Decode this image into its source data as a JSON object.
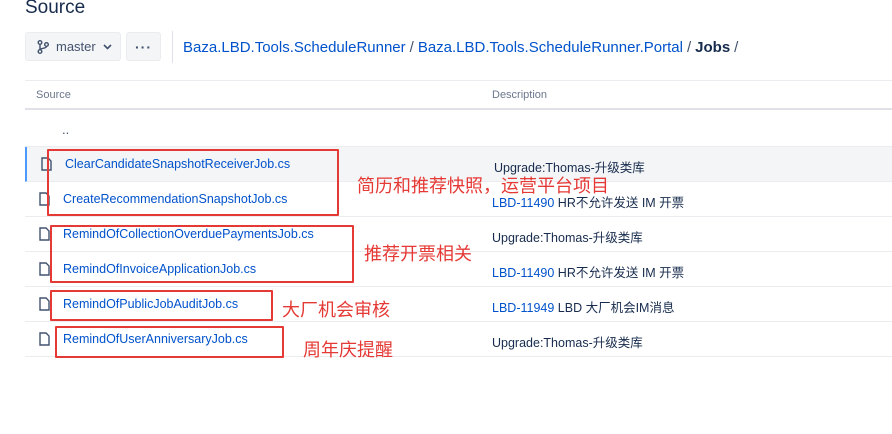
{
  "page": {
    "title": "Source"
  },
  "toolbar": {
    "branch_label": "master",
    "more_label": "···"
  },
  "breadcrumb": {
    "items": [
      "Baza.LBD.Tools.ScheduleRunner",
      "Baza.LBD.Tools.ScheduleRunner.Portal"
    ],
    "current": "Jobs",
    "separator": "/"
  },
  "table": {
    "headers": {
      "source": "Source",
      "description": "Description"
    },
    "updir": "..",
    "rows": [
      {
        "name": "ClearCandidateSnapshotReceiverJob.cs",
        "issue": "",
        "desc": "Upgrade:Thomas-升级类库",
        "selected": true
      },
      {
        "name": "CreateRecommendationSnapshotJob.cs",
        "issue": "LBD-11490",
        "desc": " HR不允许发送 IM 开票"
      },
      {
        "name": "RemindOfCollectionOverduePaymentsJob.cs",
        "issue": "",
        "desc": "Upgrade:Thomas-升级类库"
      },
      {
        "name": "RemindOfInvoiceApplicationJob.cs",
        "issue": "LBD-11490",
        "desc": " HR不允许发送 IM 开票"
      },
      {
        "name": "RemindOfPublicJobAuditJob.cs",
        "issue": "LBD-11949",
        "desc": " LBD 大厂机会IM消息"
      },
      {
        "name": "RemindOfUserAnniversaryJob.cs",
        "issue": "",
        "desc": "Upgrade:Thomas-升级类库"
      }
    ]
  },
  "annotations": {
    "group1": "简历和推荐快照，运营平台项目",
    "group2": "推荐开票相关",
    "group3": "大厂机会审核",
    "group4": "周年庆提醒",
    "color": "#e53935"
  }
}
